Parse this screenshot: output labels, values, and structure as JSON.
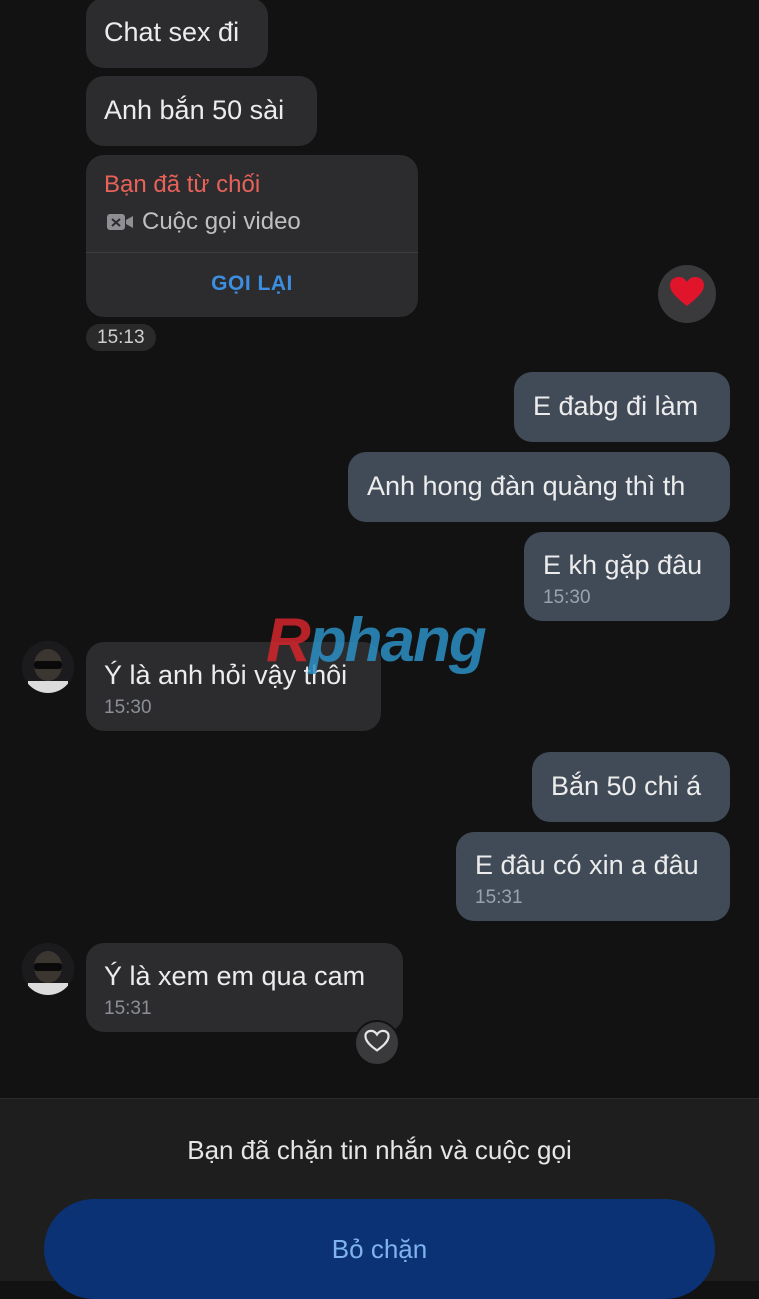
{
  "messages": {
    "m1": {
      "text": "Chat sex đi"
    },
    "m2": {
      "text": "Anh bắn 50 sài"
    },
    "call": {
      "status": "Bạn đã từ chối",
      "type": "Cuộc gọi video",
      "action": "GỌI LẠI",
      "time": "15:13",
      "reaction": "heart"
    },
    "m3": {
      "text": "E đabg đi làm"
    },
    "m4": {
      "text": "Anh hong đàn quàng thì th"
    },
    "m5": {
      "text": "E kh gặp đâu",
      "time": "15:30"
    },
    "m6": {
      "text": "Ý là anh hỏi vậy thôi",
      "time": "15:30"
    },
    "m7": {
      "text": "Bắn 50 chi á"
    },
    "m8": {
      "text": "E đâu có xin a đâu",
      "time": "15:31"
    },
    "m9": {
      "text": "Ý là xem em qua cam",
      "time": "15:31"
    }
  },
  "watermark": {
    "first": "R",
    "rest": "phang"
  },
  "footer": {
    "blocked_text": "Bạn đã chặn tin nhắn và cuộc gọi",
    "unblock_label": "Bỏ chặn"
  },
  "colors": {
    "incoming_bubble": "#2c2c2e",
    "outgoing_bubble": "#414b58",
    "declined_red": "#e8625a",
    "call_again_blue": "#3b8ee0",
    "unblock_bg": "#0b3275"
  }
}
